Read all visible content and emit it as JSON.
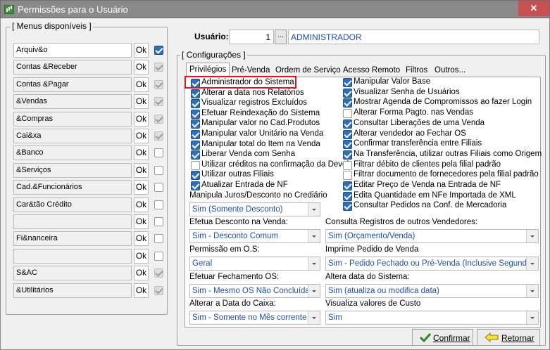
{
  "window": {
    "title": "Permissões para o Usuário",
    "close_symbol": "✕"
  },
  "menus": {
    "title": "[ Menus disponíveis ]",
    "items": [
      {
        "label": "Arquiv&o",
        "ok": "Ok",
        "checked": true
      },
      {
        "label": "Contas &Receber",
        "ok": "Ok",
        "checked": true
      },
      {
        "label": "Contas &Pagar",
        "ok": "Ok",
        "checked": true
      },
      {
        "label": "&Vendas",
        "ok": "Ok",
        "checked": true
      },
      {
        "label": "&Compras",
        "ok": "Ok",
        "checked": true
      },
      {
        "label": "Cai&xa",
        "ok": "Ok",
        "checked": true
      },
      {
        "label": "&Banco",
        "ok": "Ok",
        "checked": false
      },
      {
        "label": "&Serviços",
        "ok": "Ok",
        "checked": false
      },
      {
        "label": "Cad.&Funcionários",
        "ok": "Ok",
        "checked": false
      },
      {
        "label": "Car&tão Crédito",
        "ok": "Ok",
        "checked": false
      },
      {
        "label": "",
        "ok": "Ok",
        "checked": false
      },
      {
        "label": "Fi&nanceira",
        "ok": "Ok",
        "checked": false
      },
      {
        "label": "",
        "ok": "Ok",
        "checked": false
      },
      {
        "label": "S&AC",
        "ok": "Ok",
        "checked": true
      },
      {
        "label": "&Utilitários",
        "ok": "Ok",
        "checked": true
      }
    ]
  },
  "user": {
    "label": "Usuário:",
    "code": "1",
    "lookup_label": "...",
    "name": "ADMINISTRADOR"
  },
  "config": {
    "title": "[ Configurações ]"
  },
  "tabs": [
    "Privilégios",
    "Pré-Venda",
    "Ordem de Serviço",
    "Acesso Remoto",
    "Filtros",
    "Outros..."
  ],
  "permissions_left": [
    {
      "label": "Administrador do Sistema",
      "checked": true
    },
    {
      "label": "Alterar a data nos Relatórios",
      "checked": true
    },
    {
      "label": "Visualizar registros Excluídos",
      "checked": true
    },
    {
      "label": "Efetuar Reindexação do Sistema",
      "checked": true
    },
    {
      "label": "Manipular valor no Cad.Produtos",
      "checked": true
    },
    {
      "label": "Manipular valor Unitário na Venda",
      "checked": true
    },
    {
      "label": "Manipular total do Item na Venda",
      "checked": true
    },
    {
      "label": "Liberar Venda com Senha",
      "checked": true
    },
    {
      "label": "Utilizar créditos na confirmação da Devol.",
      "checked": false
    },
    {
      "label": "Utilizar outras Filiais",
      "checked": true
    },
    {
      "label": "Atualizar Entrada de NF",
      "checked": true
    }
  ],
  "permissions_right": [
    {
      "label": "Manipular Valor Base",
      "checked": true
    },
    {
      "label": "Visualizar Senha de Usuários",
      "checked": true
    },
    {
      "label": "Mostrar Agenda de Compromissos ao fazer Login",
      "checked": true
    },
    {
      "label": "Alterar Forma Pagto. nas Vendas",
      "checked": false
    },
    {
      "label": "Consultar Liberações de uma Venda",
      "checked": true
    },
    {
      "label": "Alterar vendedor ao Fechar OS",
      "checked": true
    },
    {
      "label": "Confirmar transferência entre Filiais",
      "checked": true
    },
    {
      "label": "Na Transferência, utilizar outras Filiais como Origem",
      "checked": true
    },
    {
      "label": "Filtrar débito de clientes pela filial padrão",
      "checked": false
    },
    {
      "label": "Filtrar documento de fornecedores pela filial padrão",
      "checked": false
    },
    {
      "label": "Editar Preço de Venda na Entrada de NF",
      "checked": true
    },
    {
      "label": "Edita Quantidade em NFe Importada de XML",
      "checked": true
    },
    {
      "label": "Consultar Pedidos na Conf. de Mercadoria",
      "checked": true
    }
  ],
  "selects": {
    "juros": {
      "label": "Manipula Juros/Desconto no Crediário",
      "value": "Sim (Somente Desconto)"
    },
    "desconto": {
      "label": "Efetua Desconto na Venda:",
      "value": "Sim - Desconto Comum"
    },
    "consulta_registros": {
      "label": "Consulta Registros de outros Vendedores:",
      "value": "Sim (Orçamento/Venda)"
    },
    "permissao_os": {
      "label": "Permissão em O.S:",
      "value": "Geral"
    },
    "imprime_pedido": {
      "label": "Imprime Pedido de Venda",
      "value": "Sim - Pedido Fechado ou Pré-Venda (Inclusive Segunda-Via)"
    },
    "fechamento_os": {
      "label": "Efetuar Fechamento OS:",
      "value": "Sim - Mesmo OS Não Concluída"
    },
    "altera_data": {
      "label": "Altera data do Sistema:",
      "value": "Sim (atualiza ou modifica data)"
    },
    "data_caixa": {
      "label": "Alterar a Data do Caixa:",
      "value": "Sim - Somente no Mês corrente"
    },
    "valores_custo": {
      "label": "Visualiza valores de Custo",
      "value": "Sim"
    }
  },
  "buttons": {
    "confirm": "Confirmar",
    "back": "Retornar"
  },
  "colors": {
    "accent": "#2e6fb8",
    "value_text": "#1f4fb0",
    "highlight": "#e0141e",
    "titlebar": "#8a8a8a"
  }
}
